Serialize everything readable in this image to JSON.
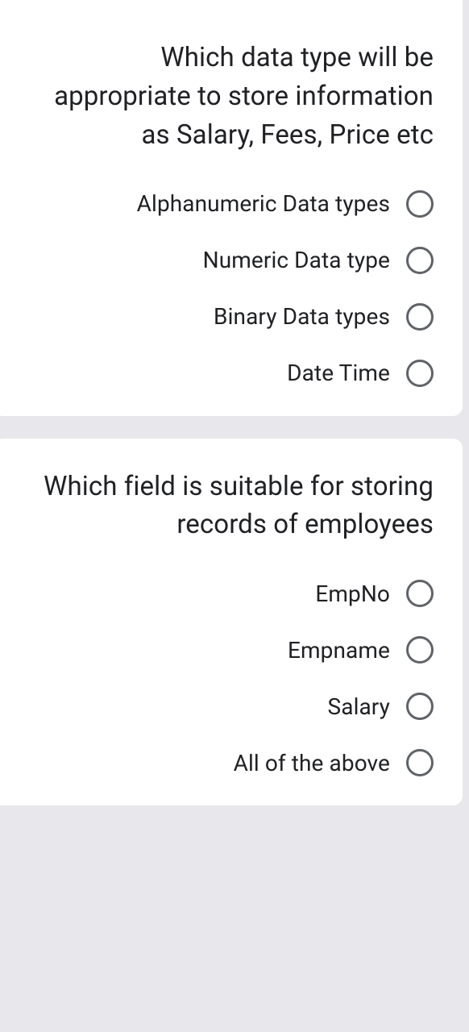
{
  "questions": [
    {
      "text": "Which data type will be appropriate to store information as Salary, Fees, Price etc",
      "options": [
        {
          "label": "Alphanumeric Data types"
        },
        {
          "label": "Numeric Data type"
        },
        {
          "label": "Binary Data types"
        },
        {
          "label": "Date Time"
        }
      ]
    },
    {
      "text": "Which field is suitable for storing records of employees",
      "options": [
        {
          "label": "EmpNo"
        },
        {
          "label": "Empname"
        },
        {
          "label": "Salary"
        },
        {
          "label": "All of the above"
        }
      ]
    }
  ]
}
